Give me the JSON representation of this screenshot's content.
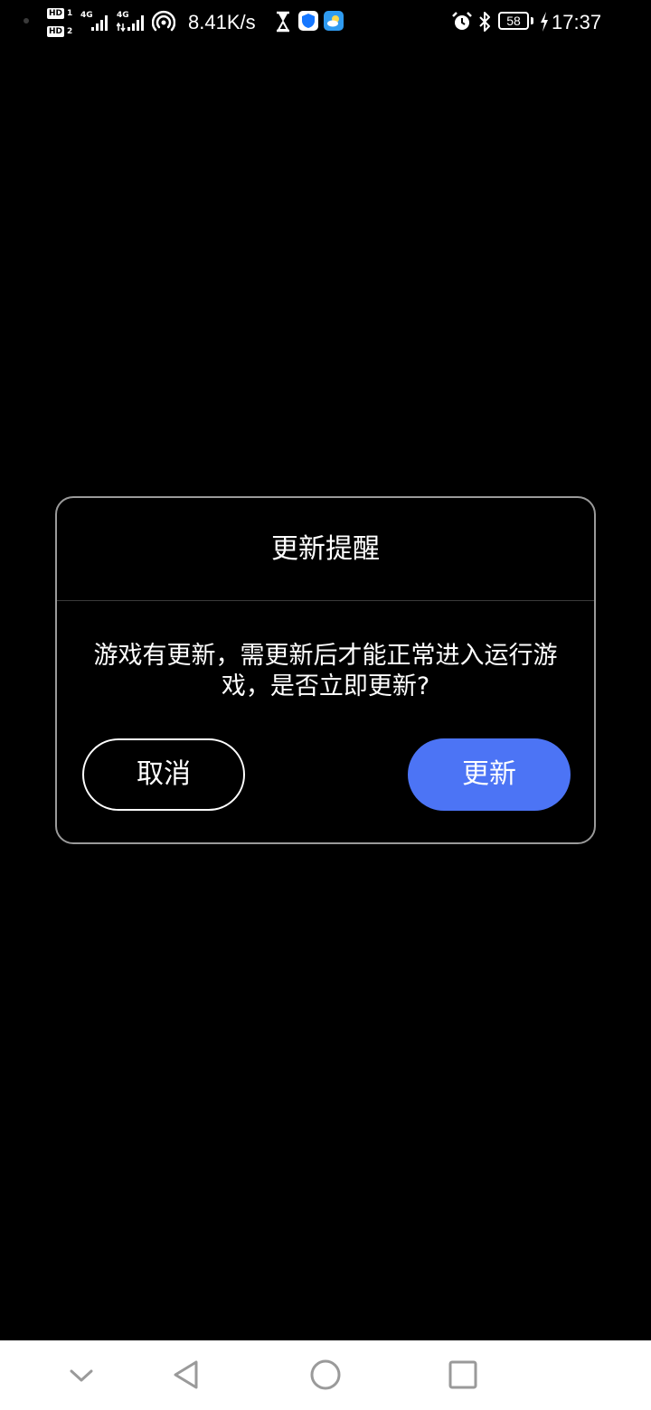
{
  "status_bar": {
    "network_speed": "8.41K/s",
    "sim1_label": "HD",
    "sim1_num": "1",
    "sim2_label": "HD",
    "sim2_num": "2",
    "signal1_type": "4G",
    "signal2_type": "4G",
    "battery_level": "58",
    "time": "17:37",
    "colors": {
      "weather_app": "#2f9bf0",
      "shield_app": "#1677ff"
    },
    "icons": [
      "wifi-hotspot-icon",
      "hourglass-icon",
      "shield-app-icon",
      "weather-app-icon",
      "alarm-icon",
      "bluetooth-icon",
      "battery-icon",
      "charging-icon"
    ]
  },
  "dialog": {
    "title": "更新提醒",
    "message": "游戏有更新，需更新后才能正常进入运行游戏，是否立即更新?",
    "cancel_label": "取消",
    "update_label": "更新",
    "colors": {
      "primary": "#4c74f5",
      "border": "#9a9a9a"
    }
  },
  "nav_bar": {
    "icons": [
      "collapse-icon",
      "back-icon",
      "home-icon",
      "recents-icon"
    ]
  }
}
